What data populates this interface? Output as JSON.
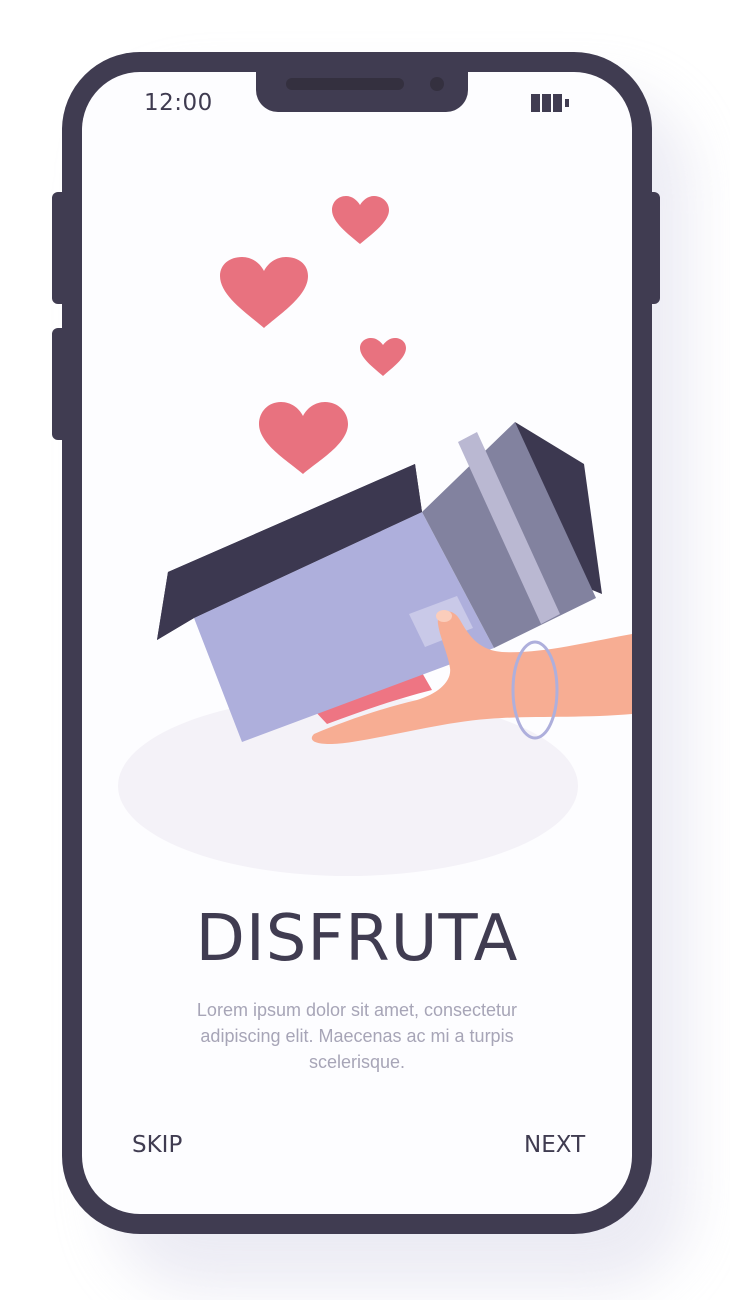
{
  "status_bar": {
    "time": "12:00",
    "battery_icon": "battery-icon"
  },
  "onboarding": {
    "title": "DISFRUTA",
    "description": "Lorem ipsum dolor sit amet, consectetur adipiscing elit. Maecenas ac mi a turpis scelerisque.",
    "skip_label": "SKIP",
    "next_label": "NEXT"
  },
  "illustration": {
    "subject": "hand-holding-open-box-with-hearts",
    "heart_count": 4
  },
  "colors": {
    "frame": "#403c51",
    "heart": "#e8727f",
    "box": "#aeafdc",
    "box_dark": "#82829f",
    "skin": "#f7ad93",
    "text_muted": "#a7a5b7"
  }
}
